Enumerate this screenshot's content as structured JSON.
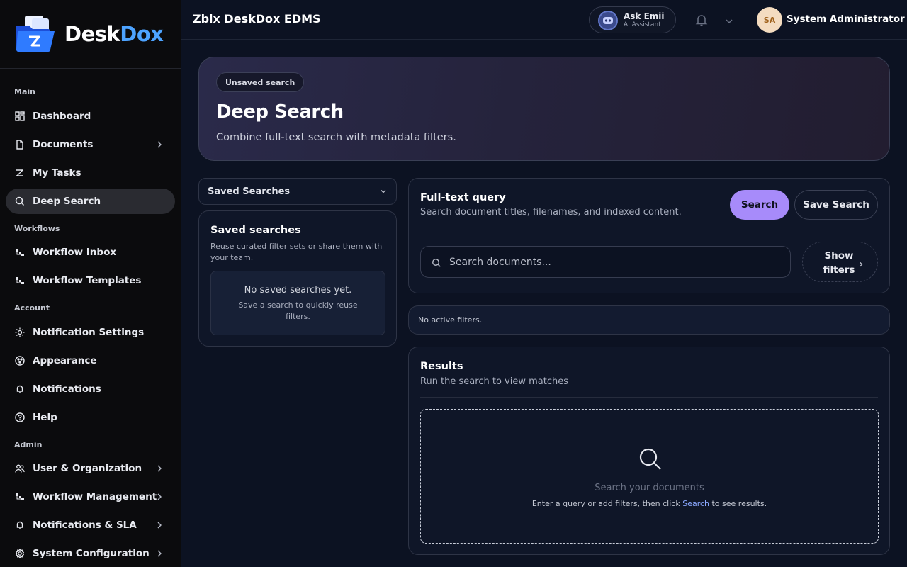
{
  "brand": {
    "name_part1": "Desk",
    "name_part2": "Dox",
    "accent": "#4da3ff"
  },
  "header": {
    "app_title": "Zbix DeskDox EDMS",
    "assistant": {
      "title": "Ask Emii",
      "subtitle": "AI Assistant"
    },
    "user": {
      "initials": "SA",
      "name": "System Administrator"
    }
  },
  "sidebar": {
    "sections": {
      "main": "Main",
      "workflows": "Workflows",
      "account": "Account",
      "admin": "Admin"
    },
    "items": {
      "dashboard": "Dashboard",
      "documents": "Documents",
      "my_tasks": "My Tasks",
      "deep_search": "Deep Search",
      "workflow_inbox": "Workflow Inbox",
      "workflow_templates": "Workflow Templates",
      "notification_settings": "Notification Settings",
      "appearance": "Appearance",
      "notifications": "Notifications",
      "help": "Help",
      "user_org": "User & Organization",
      "workflow_management": "Workflow Management",
      "notifications_sla": "Notifications & SLA",
      "system_configuration": "System Configuration"
    },
    "active": "deep_search"
  },
  "hero": {
    "badge": "Unsaved search",
    "title": "Deep Search",
    "subtitle": "Combine full-text search with metadata filters."
  },
  "saved": {
    "select_label": "Saved Searches",
    "title": "Saved searches",
    "description": "Reuse curated filter sets or share them with your team.",
    "empty_title": "No saved searches yet.",
    "empty_hint": "Save a search to quickly reuse filters."
  },
  "query": {
    "title": "Full-text query",
    "subtitle": "Search document titles, filenames, and indexed content.",
    "search_button": "Search",
    "save_button": "Save Search",
    "input_placeholder": "Search documents...",
    "input_value": "",
    "filters_button": "Show filters"
  },
  "filters": {
    "status": "No active filters."
  },
  "results": {
    "title": "Results",
    "subtitle": "Run the search to view matches",
    "empty_title": "Search your documents",
    "hint_before": "Enter a query or add filters, then click ",
    "hint_link": "Search",
    "hint_after": " to see results."
  },
  "colors": {
    "primary_button": "#a78bfa",
    "background": "#0c1222",
    "sidebar": "#0b0b0d"
  }
}
